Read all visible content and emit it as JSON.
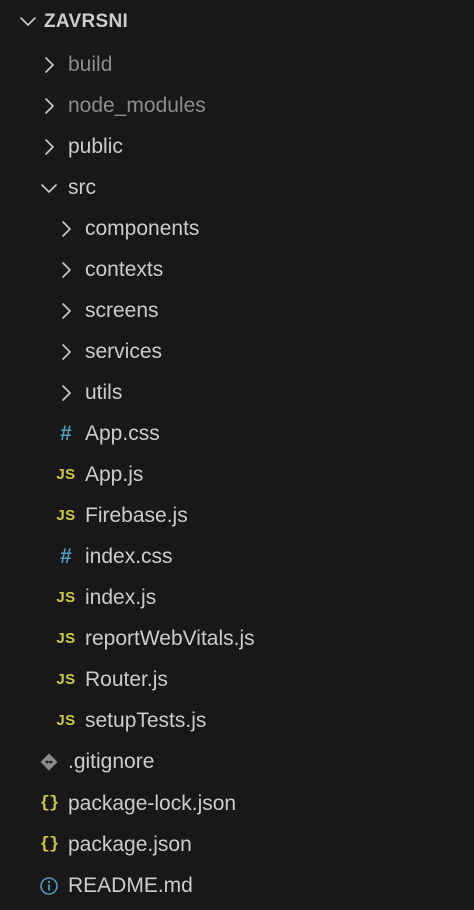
{
  "explorer": {
    "section_title": "ZAVRSNI",
    "items": [
      {
        "label": "build",
        "kind": "folder",
        "expanded": false,
        "depth": 1,
        "dim": true
      },
      {
        "label": "node_modules",
        "kind": "folder",
        "expanded": false,
        "depth": 1,
        "dim": true
      },
      {
        "label": "public",
        "kind": "folder",
        "expanded": false,
        "depth": 1,
        "dim": false
      },
      {
        "label": "src",
        "kind": "folder",
        "expanded": true,
        "depth": 1,
        "dim": false
      },
      {
        "label": "components",
        "kind": "folder",
        "expanded": false,
        "depth": 2,
        "dim": false
      },
      {
        "label": "contexts",
        "kind": "folder",
        "expanded": false,
        "depth": 2,
        "dim": false
      },
      {
        "label": "screens",
        "kind": "folder",
        "expanded": false,
        "depth": 2,
        "dim": false
      },
      {
        "label": "services",
        "kind": "folder",
        "expanded": false,
        "depth": 2,
        "dim": false
      },
      {
        "label": "utils",
        "kind": "folder",
        "expanded": false,
        "depth": 2,
        "dim": false
      },
      {
        "label": "App.css",
        "kind": "css",
        "depth": 2,
        "dim": false
      },
      {
        "label": "App.js",
        "kind": "js",
        "depth": 2,
        "dim": false
      },
      {
        "label": "Firebase.js",
        "kind": "js",
        "depth": 2,
        "dim": false
      },
      {
        "label": "index.css",
        "kind": "css",
        "depth": 2,
        "dim": false
      },
      {
        "label": "index.js",
        "kind": "js",
        "depth": 2,
        "dim": false
      },
      {
        "label": "reportWebVitals.js",
        "kind": "js",
        "depth": 2,
        "dim": false
      },
      {
        "label": "Router.js",
        "kind": "js",
        "depth": 2,
        "dim": false
      },
      {
        "label": "setupTests.js",
        "kind": "js",
        "depth": 2,
        "dim": false
      },
      {
        "label": ".gitignore",
        "kind": "git",
        "depth": 1,
        "dim": false
      },
      {
        "label": "package-lock.json",
        "kind": "json",
        "depth": 1,
        "dim": false
      },
      {
        "label": "package.json",
        "kind": "json",
        "depth": 1,
        "dim": false
      },
      {
        "label": "README.md",
        "kind": "info",
        "depth": 1,
        "dim": false
      }
    ],
    "icon_glyphs": {
      "js": "JS",
      "css": "#",
      "json": "{}"
    },
    "colors": {
      "background": "#181818",
      "text": "#cccccc",
      "text_dim": "#8b8b8b",
      "js": "#cbcb41",
      "css": "#519aba",
      "git": "#8b8b8b",
      "info": "#519aba"
    }
  }
}
